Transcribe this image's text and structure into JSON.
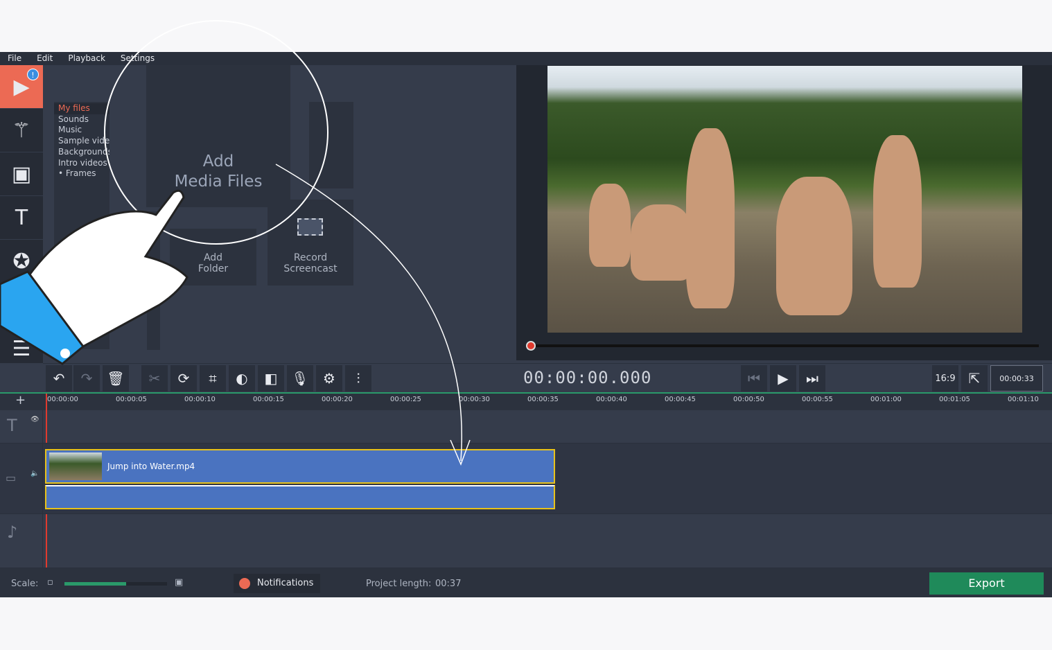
{
  "menu": [
    "File",
    "Edit",
    "Playback",
    "Settings"
  ],
  "sidebar": {
    "items": [
      "import",
      "filters",
      "transitions",
      "titles",
      "stickers",
      "callouts",
      "more"
    ],
    "badge": "!"
  },
  "categories": {
    "items": [
      "My files",
      "Sounds",
      "Music",
      "Sample videos",
      "Backgrounds",
      "Intro videos",
      "Frames"
    ],
    "selected": "My files"
  },
  "tiles": {
    "add_media": "Add\nMedia Files",
    "add_folder": "Add\nFolder",
    "record": "Record\nScreencast"
  },
  "player": {
    "timecode": "00:00:00.000",
    "aspect": "16:9",
    "duration_tooltip": "00:00:33",
    "progress": 0
  },
  "toolbar": [
    "undo",
    "redo",
    "delete",
    "cut",
    "rotate",
    "crop",
    "color",
    "transition",
    "voiceover",
    "settings",
    "equalizer"
  ],
  "ruler": [
    "00:00:00",
    "00:00:05",
    "00:00:10",
    "00:00:15",
    "00:00:20",
    "00:00:25",
    "00:00:30",
    "00:00:35",
    "00:00:40",
    "00:00:45",
    "00:00:50",
    "00:00:55",
    "00:01:00",
    "00:01:05",
    "00:01:10"
  ],
  "clip": {
    "name": "Jump into Water.mp4"
  },
  "status": {
    "scale_label": "Scale:",
    "scale_value": 0.6,
    "notifications": "Notifications",
    "project_length_label": "Project length:",
    "project_length": "00:37",
    "export": "Export"
  },
  "colors": {
    "accent": "#ec6a54",
    "export": "#1f8a5a",
    "clip": "#4a73c0",
    "clip_border": "#e8c21a"
  }
}
